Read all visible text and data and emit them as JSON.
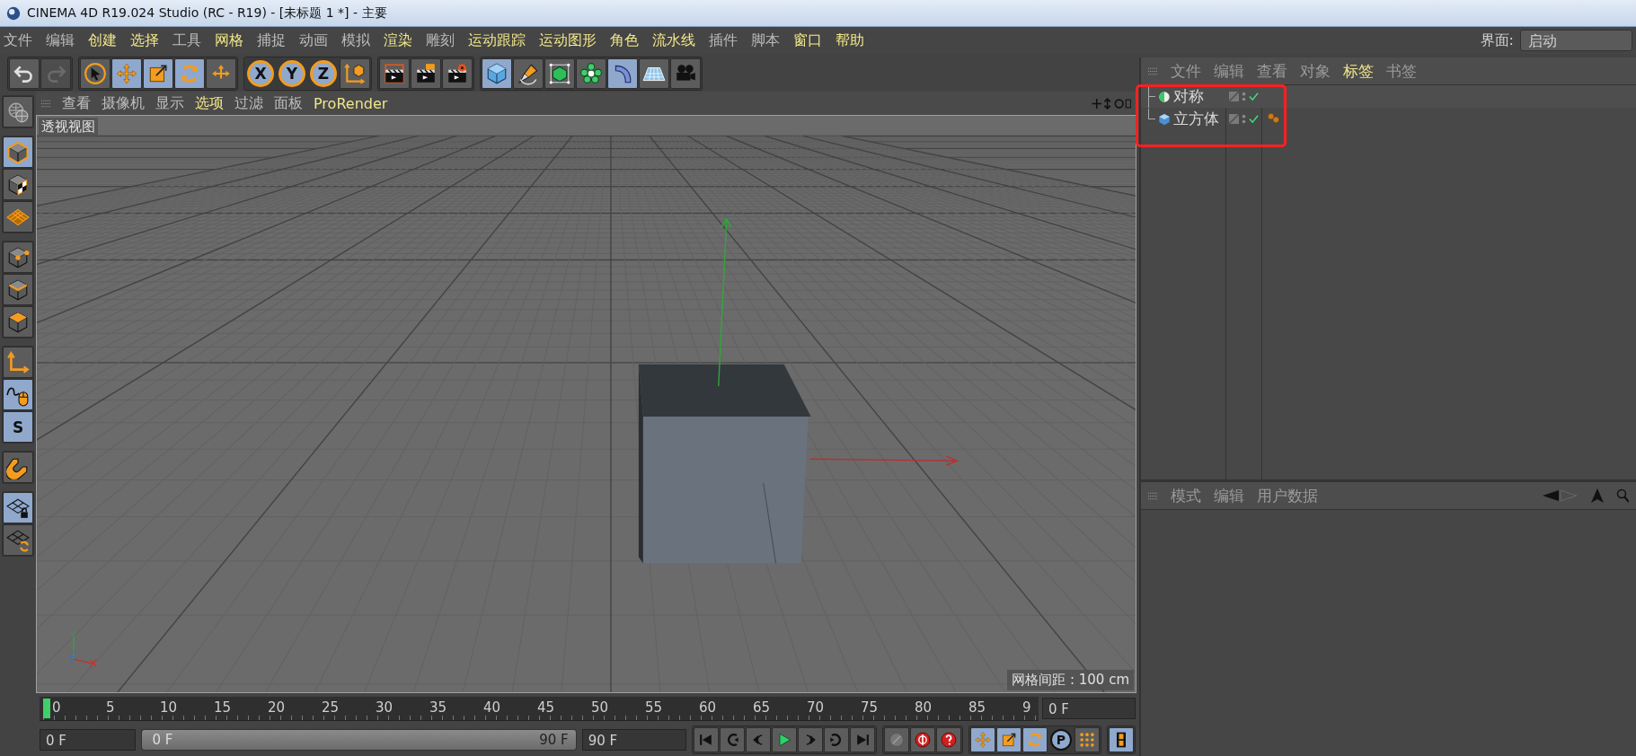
{
  "window": {
    "title": "CINEMA 4D R19.024 Studio (RC - R19) - [未标题 1 *] - 主要"
  },
  "menu": [
    {
      "label": "文件",
      "highlighted": false
    },
    {
      "label": "编辑",
      "highlighted": false
    },
    {
      "label": "创建",
      "highlighted": true
    },
    {
      "label": "选择",
      "highlighted": true
    },
    {
      "label": "工具",
      "highlighted": false
    },
    {
      "label": "网格",
      "highlighted": true
    },
    {
      "label": "捕捉",
      "highlighted": false
    },
    {
      "label": "动画",
      "highlighted": false
    },
    {
      "label": "模拟",
      "highlighted": false
    },
    {
      "label": "渲染",
      "highlighted": true
    },
    {
      "label": "雕刻",
      "highlighted": false
    },
    {
      "label": "运动跟踪",
      "highlighted": true
    },
    {
      "label": "运动图形",
      "highlighted": true
    },
    {
      "label": "角色",
      "highlighted": true
    },
    {
      "label": "流水线",
      "highlighted": true
    },
    {
      "label": "插件",
      "highlighted": false
    },
    {
      "label": "脚本",
      "highlighted": false
    },
    {
      "label": "窗口",
      "highlighted": true
    },
    {
      "label": "帮助",
      "highlighted": true
    }
  ],
  "layout": {
    "label": "界面:",
    "value": "启动"
  },
  "toolbar": [
    {
      "active": false,
      "disabled": false
    },
    {
      "active": false,
      "disabled": true
    },
    {
      "active": false,
      "disabled": false
    },
    {
      "active": true,
      "disabled": false
    },
    {
      "active": true,
      "disabled": false
    },
    {
      "active": true,
      "disabled": false
    },
    {
      "active": false,
      "disabled": false
    },
    {
      "label": "X",
      "active": true,
      "disabled": false
    },
    {
      "label": "Y",
      "active": true,
      "disabled": false
    },
    {
      "label": "Z",
      "active": true,
      "disabled": false
    },
    {
      "active": false,
      "disabled": false
    },
    {
      "active": false,
      "disabled": false
    },
    {
      "active": false,
      "disabled": false
    },
    {
      "active": false,
      "disabled": false
    },
    {
      "active": true,
      "disabled": false
    },
    {
      "active": false,
      "disabled": false
    },
    {
      "active": false,
      "disabled": false
    },
    {
      "active": false,
      "disabled": false
    },
    {
      "active": true,
      "disabled": false
    },
    {
      "active": false,
      "disabled": false
    },
    {
      "active": false,
      "disabled": false
    }
  ],
  "viewport": {
    "menu": [
      {
        "label": "查看",
        "highlighted": false
      },
      {
        "label": "摄像机",
        "highlighted": false
      },
      {
        "label": "显示",
        "highlighted": false
      },
      {
        "label": "选项",
        "highlighted": true
      },
      {
        "label": "过滤",
        "highlighted": false
      },
      {
        "label": "面板",
        "highlighted": false
      },
      {
        "label": "ProRender",
        "highlighted": true
      }
    ],
    "view_name": "透视视图",
    "grid_info": "网格间距 : 100 cm"
  },
  "left_toolbar": [
    {
      "active": false
    },
    {
      "active": true
    },
    {
      "active": false
    },
    {
      "active": false
    },
    {
      "active": false
    },
    {
      "active": false
    },
    {
      "active": false
    },
    {
      "active": false
    },
    {
      "active": true
    },
    {
      "label": "S",
      "active": true
    },
    {
      "active": false
    },
    {
      "active": true
    },
    {
      "active": false
    }
  ],
  "object_manager": {
    "tabs": [
      {
        "label": "文件",
        "highlighted": false
      },
      {
        "label": "编辑",
        "highlighted": false
      },
      {
        "label": "查看",
        "highlighted": false
      },
      {
        "label": "对象",
        "highlighted": false
      },
      {
        "label": "标签",
        "highlighted": true
      },
      {
        "label": "书签",
        "highlighted": false
      }
    ],
    "objects": [
      {
        "kind": "symmetry",
        "name": "对称",
        "enabled": true,
        "has_tag": false
      },
      {
        "kind": "cube",
        "name": "立方体",
        "enabled": true,
        "has_tag": true
      }
    ]
  },
  "attribute_manager": {
    "tabs": [
      "模式",
      "编辑",
      "用户数据"
    ]
  },
  "timeline": {
    "ticks": [
      "0",
      "5",
      "10",
      "15",
      "20",
      "25",
      "30",
      "35",
      "40",
      "45",
      "50",
      "55",
      "60",
      "65",
      "70",
      "75",
      "80",
      "85",
      "9"
    ],
    "level": 0,
    "current": "0 F"
  },
  "playback": {
    "start": "0 F",
    "range_start": "0 F",
    "range_end": "90 F",
    "end": "90 F",
    "level": 1
  },
  "key_buttons": [
    {
      "active": false
    },
    {
      "active": false
    },
    {
      "active": false
    },
    {
      "active": true
    },
    {
      "active": true
    },
    {
      "active": true
    },
    {
      "label": "P",
      "active": true
    },
    {
      "active": false
    }
  ]
}
